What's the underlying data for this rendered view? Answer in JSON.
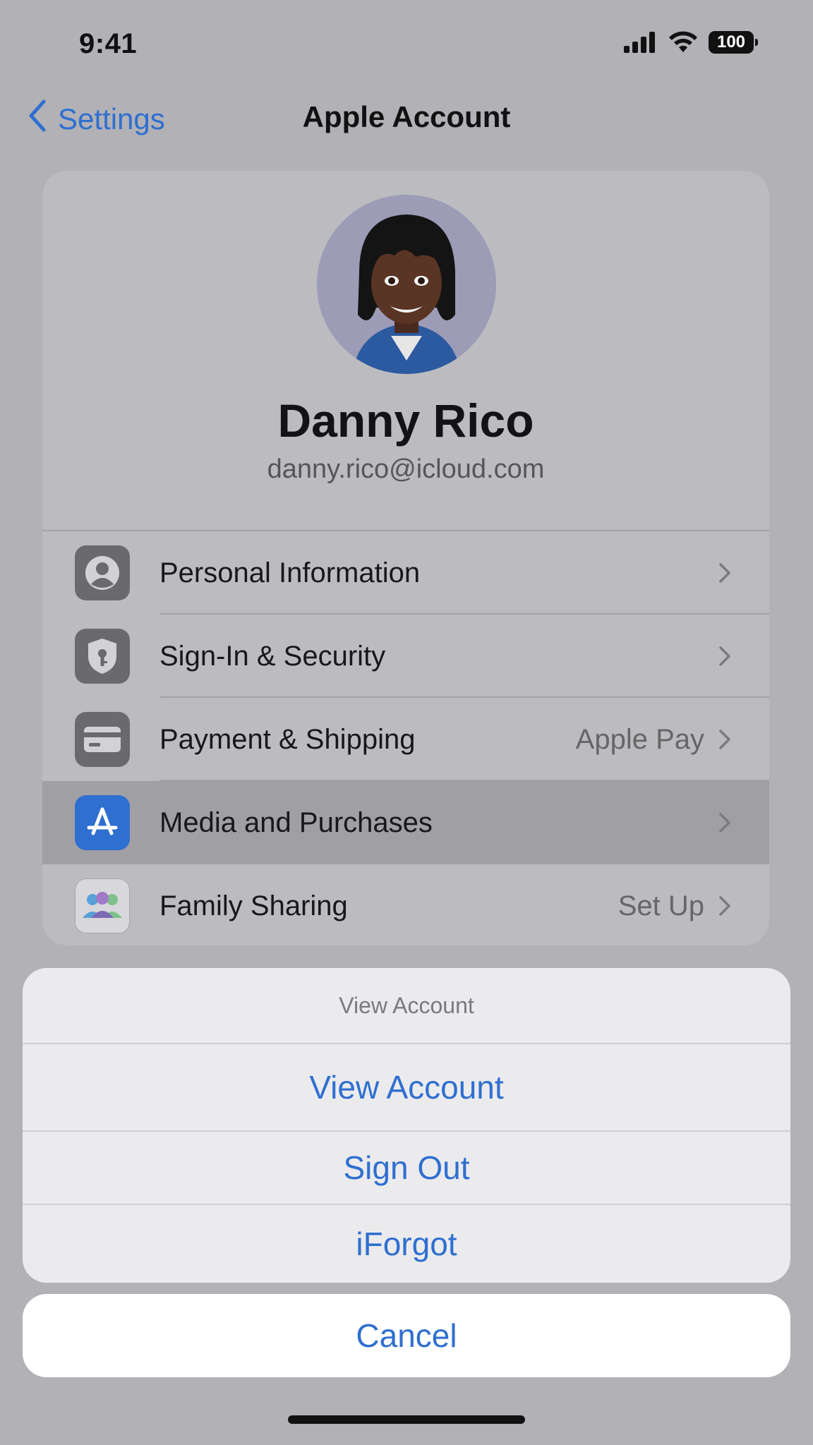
{
  "status_bar": {
    "time": "9:41",
    "battery": "100"
  },
  "nav": {
    "back_label": "Settings",
    "title": "Apple Account"
  },
  "profile": {
    "name": "Danny Rico",
    "email": "danny.rico@icloud.com"
  },
  "rows": [
    {
      "label": "Personal Information",
      "value": "",
      "icon": "person-icon"
    },
    {
      "label": "Sign-In & Security",
      "value": "",
      "icon": "shield-key-icon"
    },
    {
      "label": "Payment & Shipping",
      "value": "Apple Pay",
      "icon": "credit-card-icon"
    },
    {
      "label": "Media and Purchases",
      "value": "",
      "icon": "app-store-icon"
    },
    {
      "label": "Family Sharing",
      "value": "Set Up",
      "icon": "family-icon"
    }
  ],
  "action_sheet": {
    "title": "View Account",
    "actions": [
      "View Account",
      "Sign Out",
      "iForgot"
    ],
    "cancel": "Cancel"
  },
  "colors": {
    "accent": "#2f6fd0",
    "dimmed_background": "#b1b1b6",
    "sheet_background": "#ebebed"
  }
}
